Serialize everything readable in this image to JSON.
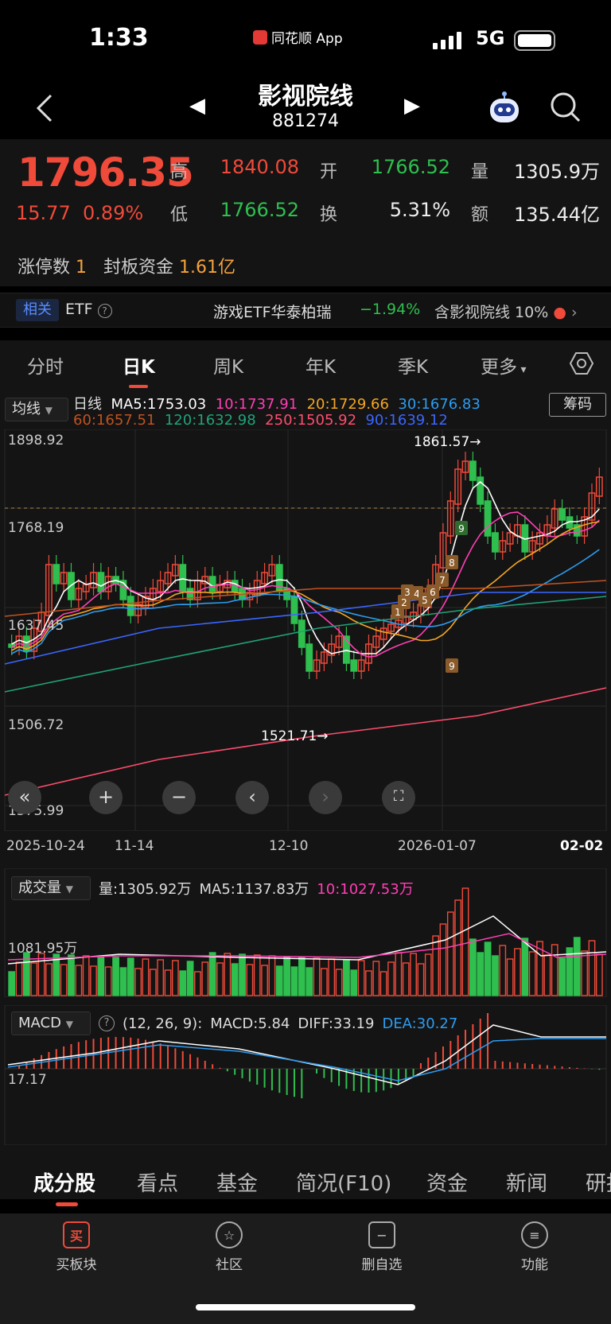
{
  "status": {
    "time": "1:33",
    "app": "同花顺 App",
    "network": "5G"
  },
  "header": {
    "title": "影视院线",
    "code": "881274"
  },
  "quote": {
    "price": "1796.35",
    "change": "15.77",
    "change_pct": "0.89%",
    "high_label": "高",
    "high": "1840.08",
    "open_label": "开",
    "open": "1766.52",
    "volume_label": "量",
    "volume": "1305.9万",
    "low_label": "低",
    "low": "1766.52",
    "turnover_label": "换",
    "turnover": "5.31%",
    "amount_label": "额",
    "amount": "135.44亿",
    "limit_up_label": "涨停数",
    "limit_up_count": "1",
    "seal_label": "封板资金",
    "seal_amount": "1.61亿"
  },
  "etf": {
    "tag": "相关",
    "label": "ETF",
    "name": "游戏ETF华泰柏瑞",
    "change": "−1.94%",
    "holding": "含影视院线 10%"
  },
  "period_tabs": [
    "分时",
    "日K",
    "周K",
    "年K",
    "季K",
    "更多"
  ],
  "ma": {
    "select": "均线",
    "line": "日线",
    "ma5": "MA5:1753.03",
    "ma10": "10:1737.91",
    "ma20": "20:1729.66",
    "ma30": "30:1676.83",
    "ma60": "60:1657.51",
    "ma120": "120:1632.98",
    "ma250": "250:1505.92",
    "ma90": "90:1639.12",
    "chip": "筹码"
  },
  "kline": {
    "y_labels": [
      "1898.92",
      "1768.19",
      "1637.45",
      "1506.72",
      "1375.99"
    ],
    "high_mark": "1861.57→",
    "low_mark": "1521.71→",
    "x_labels": [
      "2025-10-24",
      "11-14",
      "12-10",
      "2026-01-07",
      "02-02"
    ],
    "seq_markers": [
      "1",
      "2",
      "3",
      "4",
      "5",
      "6",
      "7",
      "8",
      "9",
      "9"
    ]
  },
  "volume": {
    "select": "成交量",
    "vol": "量:1305.92万",
    "ma5": "MA5:1137.83万",
    "ma10": "10:1027.53万",
    "y_label": "1081.95万"
  },
  "macd": {
    "select": "MACD",
    "params": "(12, 26, 9):",
    "macd": "MACD:5.84",
    "diff": "DIFF:33.19",
    "dea": "DEA:30.27",
    "y_label": "17.17"
  },
  "bottom_tabs": [
    "成分股",
    "看点",
    "基金",
    "简况(F10)",
    "资金",
    "新闻",
    "研报"
  ],
  "tab_bar": [
    {
      "label": "买板块",
      "icon": "buy-icon",
      "glyph": "买"
    },
    {
      "label": "社区",
      "icon": "community-icon",
      "glyph": "☆"
    },
    {
      "label": "删自选",
      "icon": "remove-watchlist-icon",
      "glyph": "−"
    },
    {
      "label": "功能",
      "icon": "menu-icon",
      "glyph": "≡"
    }
  ],
  "colors": {
    "up": "#f04a3a",
    "down": "#2fbf4f",
    "ma5": "#ffffff",
    "ma10": "#ff3fb4",
    "ma20": "#f5a623",
    "ma30": "#2e9cf0",
    "ma60": "#c0521f",
    "ma120": "#1fa37a",
    "ma250": "#ff4d6d",
    "ma90": "#3b66ff"
  }
}
